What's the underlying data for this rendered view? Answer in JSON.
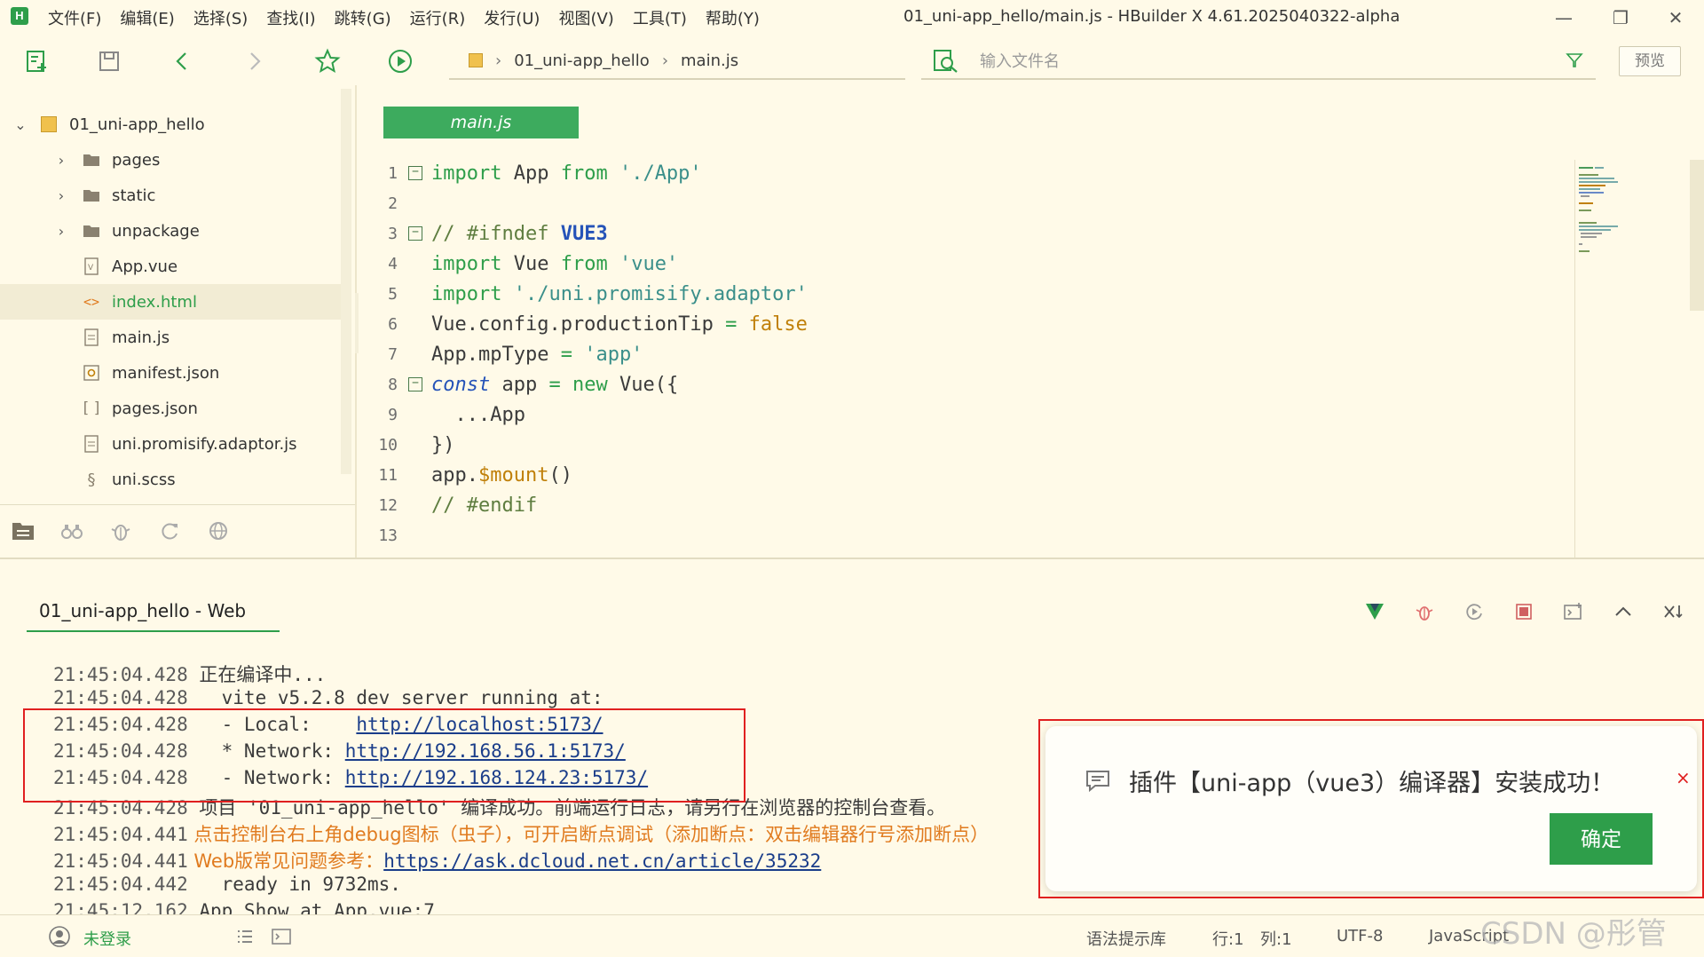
{
  "window": {
    "title": "01_uni-app_hello/main.js - HBuilder X 4.61.2025040322-alpha",
    "app_logo": "H"
  },
  "menu": [
    "文件(F)",
    "编辑(E)",
    "选择(S)",
    "查找(I)",
    "跳转(G)",
    "运行(R)",
    "发行(U)",
    "视图(V)",
    "工具(T)",
    "帮助(Y)"
  ],
  "toolbar": {
    "breadcrumb": [
      "01_uni-app_hello",
      "main.js"
    ],
    "file_search_placeholder": "输入文件名",
    "preview_label": "预览"
  },
  "sidebar": {
    "project": "01_uni-app_hello",
    "items": [
      {
        "label": "pages",
        "type": "folder"
      },
      {
        "label": "static",
        "type": "folder"
      },
      {
        "label": "unpackage",
        "type": "folder"
      },
      {
        "label": "App.vue",
        "type": "vue"
      },
      {
        "label": "index.html",
        "type": "html",
        "selected": true
      },
      {
        "label": "main.js",
        "type": "js"
      },
      {
        "label": "manifest.json",
        "type": "manifest"
      },
      {
        "label": "pages.json",
        "type": "json"
      },
      {
        "label": "uni.promisify.adaptor.js",
        "type": "js"
      },
      {
        "label": "uni.scss",
        "type": "scss"
      }
    ]
  },
  "editor": {
    "tab": "main.js",
    "line_numbers": [
      "1",
      "2",
      "3",
      "4",
      "5",
      "6",
      "7",
      "8",
      "9",
      "10",
      "11",
      "12",
      "13"
    ]
  },
  "console": {
    "tab": "01_uni-app_hello - Web",
    "logs": [
      {
        "time": "21:45:04.428",
        "text": " 正在编译中..."
      },
      {
        "time": "21:45:04.428",
        "text": "   vite v5.2.8 dev server running at:"
      },
      {
        "time": "21:45:04.428",
        "text": "   - Local:    ",
        "link": "http://localhost:5173/"
      },
      {
        "time": "21:45:04.428",
        "text": "   * Network: ",
        "link": "http://192.168.56.1:5173/"
      },
      {
        "time": "21:45:04.428",
        "text": "   - Network: ",
        "link": "http://192.168.124.23:5173/"
      },
      {
        "time": "21:45:04.428",
        "text": " 项目 '01_uni-app_hello' 编译成功。前端运行日志，请另行在浏览器的控制台查看。"
      },
      {
        "time": "21:45:04.441",
        "orange": " 点击控制台右上角debug图标（虫子），可开启断点调试（添加断点：双击编辑器行号添加断点）"
      },
      {
        "time": "21:45:04.441",
        "orange": " Web版常见问题参考：",
        "link": "https://ask.dcloud.net.cn/article/35232"
      },
      {
        "time": "21:45:04.442",
        "text": "   ready in 9732ms."
      },
      {
        "time": "21:45:12.162",
        "text": " App Show at App.vue:7"
      }
    ]
  },
  "notification": {
    "message": "插件【uni-app（vue3）编译器】安装成功！",
    "confirm_label": "确定",
    "close_label": "×"
  },
  "statusbar": {
    "login": "未登录",
    "syntax_lib": "语法提示库",
    "row": "行:1",
    "col": "列:1",
    "encoding": "UTF-8",
    "language": "JavaScript"
  },
  "watermark": "CSDN @彤管",
  "colors": {
    "accent": "#2e9e4a",
    "background": "#fffae8",
    "highlight_box": "#e02020",
    "link": "#1a3d8a",
    "warning_text": "#e07b1f"
  }
}
